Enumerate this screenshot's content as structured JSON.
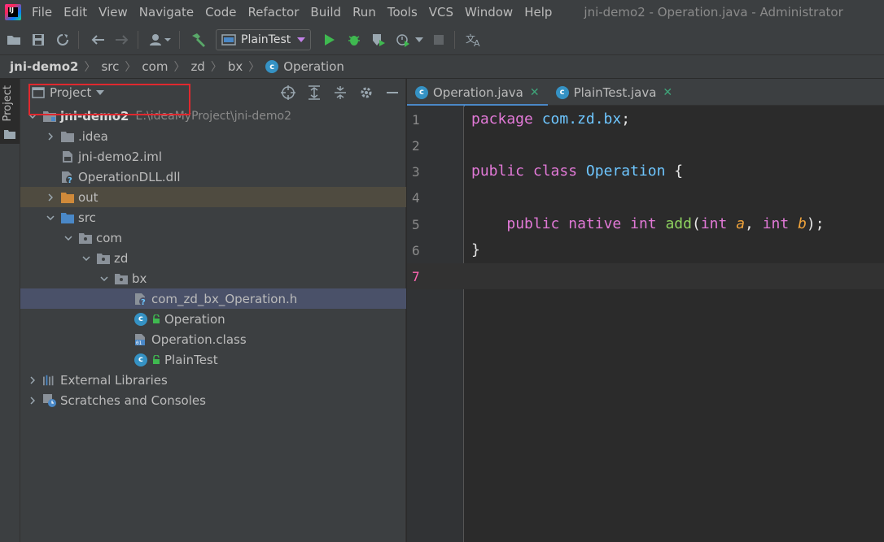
{
  "menubar": {
    "items": [
      "File",
      "Edit",
      "View",
      "Navigate",
      "Code",
      "Refactor",
      "Build",
      "Run",
      "Tools",
      "VCS",
      "Window",
      "Help"
    ],
    "window_title": "jni-demo2 - Operation.java - Administrator"
  },
  "toolbar": {
    "run_config": "PlainTest",
    "icons": [
      "open-icon",
      "save-icon",
      "sync-icon",
      "back-icon",
      "forward-icon",
      "user-icon",
      "build-hammer-icon",
      "run-icon",
      "debug-icon",
      "coverage-icon",
      "profile-icon",
      "stop-icon",
      "translate-icon"
    ]
  },
  "breadcrumb": [
    "jni-demo2",
    "src",
    "com",
    "zd",
    "bx",
    "Operation"
  ],
  "left_strip": {
    "label": "Project"
  },
  "project_panel": {
    "title": "Project",
    "tree": [
      {
        "label": "jni-demo2",
        "hint": "E:\\ideaMyProject\\jni-demo2",
        "level": 0,
        "expanded": true,
        "type": "module"
      },
      {
        "label": ".idea",
        "level": 1,
        "expanded": false,
        "type": "folder"
      },
      {
        "label": "jni-demo2.iml",
        "level": 1,
        "type": "iml"
      },
      {
        "label": "OperationDLL.dll",
        "level": 1,
        "type": "unknown"
      },
      {
        "label": "out",
        "level": 1,
        "expanded": false,
        "type": "folder-excluded"
      },
      {
        "label": "src",
        "level": 1,
        "expanded": true,
        "type": "folder-src"
      },
      {
        "label": "com",
        "level": 2,
        "expanded": true,
        "type": "package"
      },
      {
        "label": "zd",
        "level": 3,
        "expanded": true,
        "type": "package"
      },
      {
        "label": "bx",
        "level": 4,
        "expanded": true,
        "type": "package"
      },
      {
        "label": "com_zd_bx_Operation.h",
        "level": 5,
        "type": "header"
      },
      {
        "label": "Operation",
        "level": 5,
        "type": "class"
      },
      {
        "label": "Operation.class",
        "level": 5,
        "type": "binary"
      },
      {
        "label": "PlainTest",
        "level": 5,
        "type": "class-main"
      },
      {
        "label": "External Libraries",
        "level": 0,
        "expanded": false,
        "type": "libraries"
      },
      {
        "label": "Scratches and Consoles",
        "level": 0,
        "expanded": false,
        "type": "scratches"
      }
    ]
  },
  "editor": {
    "tabs": [
      {
        "label": "Operation.java",
        "active": true
      },
      {
        "label": "PlainTest.java",
        "active": false
      }
    ],
    "line_numbers": [
      "1",
      "2",
      "3",
      "4",
      "5",
      "6",
      "7"
    ],
    "code": {
      "l1_kw": "package",
      "l1_pkg": "com.zd.bx",
      "l1_end": ";",
      "l3_kw1": "public",
      "l3_kw2": "class",
      "l3_cls": "Operation",
      "l3_brace": "{",
      "l5_kw1": "public",
      "l5_kw2": "native",
      "l5_type1": "int",
      "l5_fn": "add",
      "l5_open": "(",
      "l5_type2": "int",
      "l5_p1": "a",
      "l5_comma": ",",
      "l5_type3": "int",
      "l5_p2": "b",
      "l5_close": ");",
      "l6": "}"
    }
  },
  "colors": {
    "keyword": "#e279d7",
    "identifier": "#6ec6ff",
    "function": "#8fd460",
    "parameter": "#f0a33b",
    "highlight_box": "#e0282e"
  }
}
